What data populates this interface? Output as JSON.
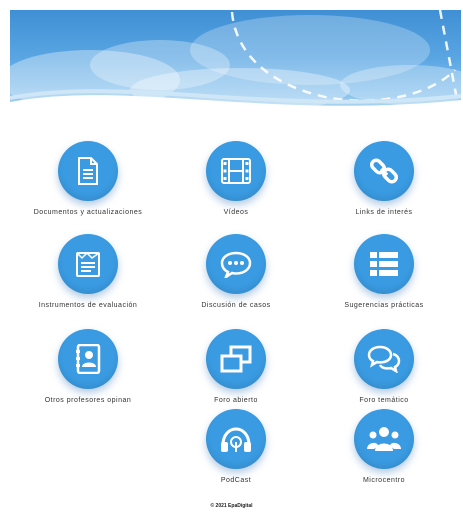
{
  "colors": {
    "accent": "#3a9be2",
    "banner_top": "#3f8fd4",
    "text": "#333333"
  },
  "tiles": [
    {
      "label": "Documentos y actualizaciones",
      "icon": "document-icon"
    },
    {
      "label": "Vídeos",
      "icon": "film-icon"
    },
    {
      "label": "Links de interés",
      "icon": "link-icon"
    },
    {
      "label": "Instrumentos de evaluación",
      "icon": "clipboard-icon"
    },
    {
      "label": "Discusión de casos",
      "icon": "chat-bubble-icon"
    },
    {
      "label": "Sugerencias prácticas",
      "icon": "list-icon"
    },
    {
      "label": "Otros profesores opinan",
      "icon": "contacts-book-icon"
    },
    {
      "label": "Foro abierto",
      "icon": "windows-icon"
    },
    {
      "label": "Foro temático",
      "icon": "chat-bubbles-icon"
    },
    {
      "label": "PodCast",
      "icon": "headphones-icon"
    },
    {
      "label": "Microcentro",
      "icon": "group-icon"
    }
  ],
  "footer": {
    "text": "© 2021 EpaDigital"
  }
}
